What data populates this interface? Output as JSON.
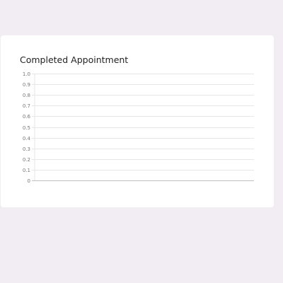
{
  "card": {
    "title": "Completed Appointment"
  },
  "chart_data": {
    "type": "line",
    "title": "Completed Appointment",
    "xlabel": "",
    "ylabel": "",
    "ylim": [
      0,
      1
    ],
    "y_ticks": [
      "1.0",
      "0.9",
      "0.8",
      "0.7",
      "0.6",
      "0.5",
      "0.4",
      "0.3",
      "0.2",
      "0.1",
      "0"
    ],
    "grid": true,
    "series": [],
    "colors": {
      "grid": "#e6e6e6",
      "axis": "#bfbfbf",
      "tick_text": "#777777"
    }
  }
}
